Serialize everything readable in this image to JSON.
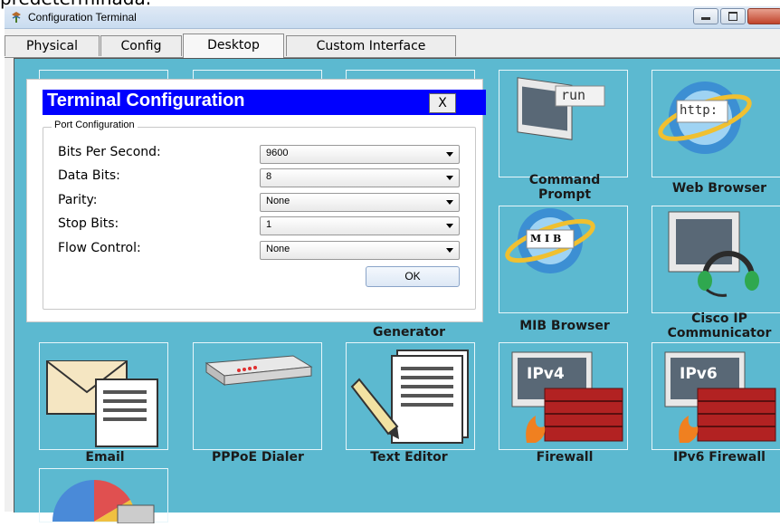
{
  "cropped_heading": "predeterminada.",
  "window": {
    "title": "Configuration Terminal"
  },
  "tabs": [
    {
      "label": "Physical"
    },
    {
      "label": "Config"
    },
    {
      "label": "Desktop"
    },
    {
      "label": "Custom Interface"
    }
  ],
  "desktop": {
    "apps": {
      "generator_partial": "Generator",
      "command_prompt": {
        "line1": "Command",
        "line2": "Prompt",
        "badge": "run"
      },
      "web_browser": {
        "label": "Web Browser",
        "badge": "http:"
      },
      "mib_browser": {
        "label": "MIB Browser",
        "badge": "M I B"
      },
      "cisco_ip": {
        "line1": "Cisco IP",
        "line2": "Communicator"
      },
      "email": {
        "label": "Email"
      },
      "pppoe": {
        "label": "PPPoE Dialer"
      },
      "text_editor": {
        "label": "Text Editor"
      },
      "firewall": {
        "label": "Firewall",
        "badge": "IPv4"
      },
      "ipv6_firewall": {
        "label": "IPv6 Firewall",
        "badge": "IPv6"
      }
    }
  },
  "dialog": {
    "title": "Terminal Configuration",
    "close_label": "X",
    "group_label": "Port Configuration",
    "fields": [
      {
        "label": "Bits Per Second:",
        "value": "9600"
      },
      {
        "label": "Data Bits:",
        "value": "8"
      },
      {
        "label": "Parity:",
        "value": "None"
      },
      {
        "label": "Stop Bits:",
        "value": "1"
      },
      {
        "label": "Flow Control:",
        "value": "None"
      }
    ],
    "ok_label": "OK"
  },
  "colors": {
    "desktop_bg": "#5cb9d0",
    "title_bar": "#0000ff"
  }
}
